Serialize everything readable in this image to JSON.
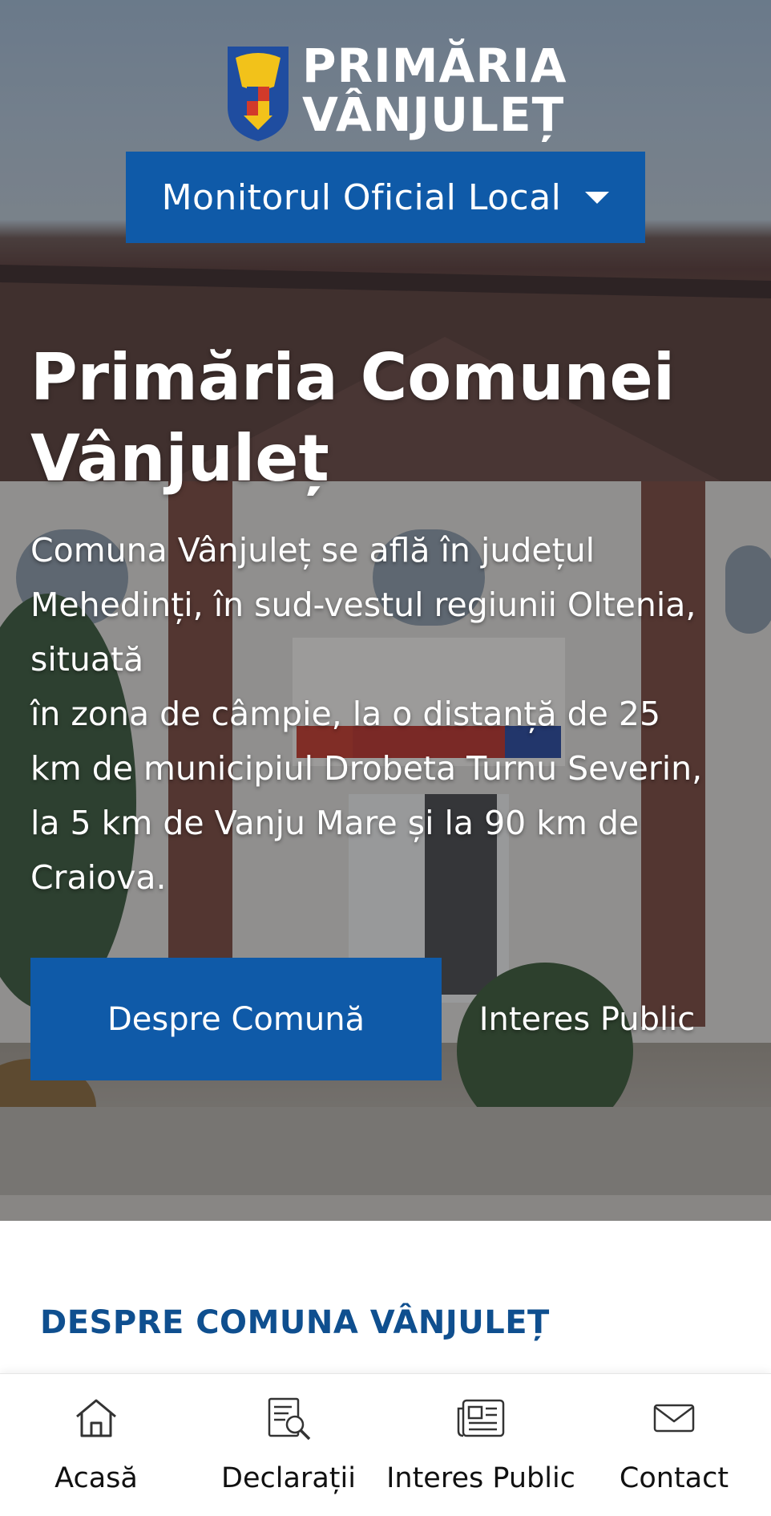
{
  "header": {
    "logo_line1": "PRIMĂRIA",
    "logo_line2": "VÂNJULEȚ",
    "logo_icon": "coat-of-arms-icon",
    "menu_label": "Monitorul Oficial Local"
  },
  "hero": {
    "title_line1": "Primăria Comunei",
    "title_line2": "Vânjuleț",
    "description": "Comuna Vânjuleț se află  în județul\nMehedinți, în sud-vestul regiunii Oltenia,\nsituată\nîn zona de câmpie, la o distanță de 25\nkm de municipiul Drobeta Turnu Severin,\nla 5 km de Vanju Mare și la 90 km de\nCraiova.",
    "primary_button": "Despre Comună",
    "secondary_button": "Interes Public"
  },
  "section": {
    "title": "DESPRE COMUNA VÂNJULEȚ"
  },
  "bottom_nav": {
    "items": [
      {
        "label": "Acasă",
        "icon": "home-icon"
      },
      {
        "label": "Declarații",
        "icon": "document-search-icon"
      },
      {
        "label": "Interes Public",
        "icon": "newspaper-icon"
      },
      {
        "label": "Contact",
        "icon": "envelope-icon"
      }
    ]
  },
  "colors": {
    "brand_blue": "#0f5aa8",
    "section_title": "#0f4f8f"
  }
}
